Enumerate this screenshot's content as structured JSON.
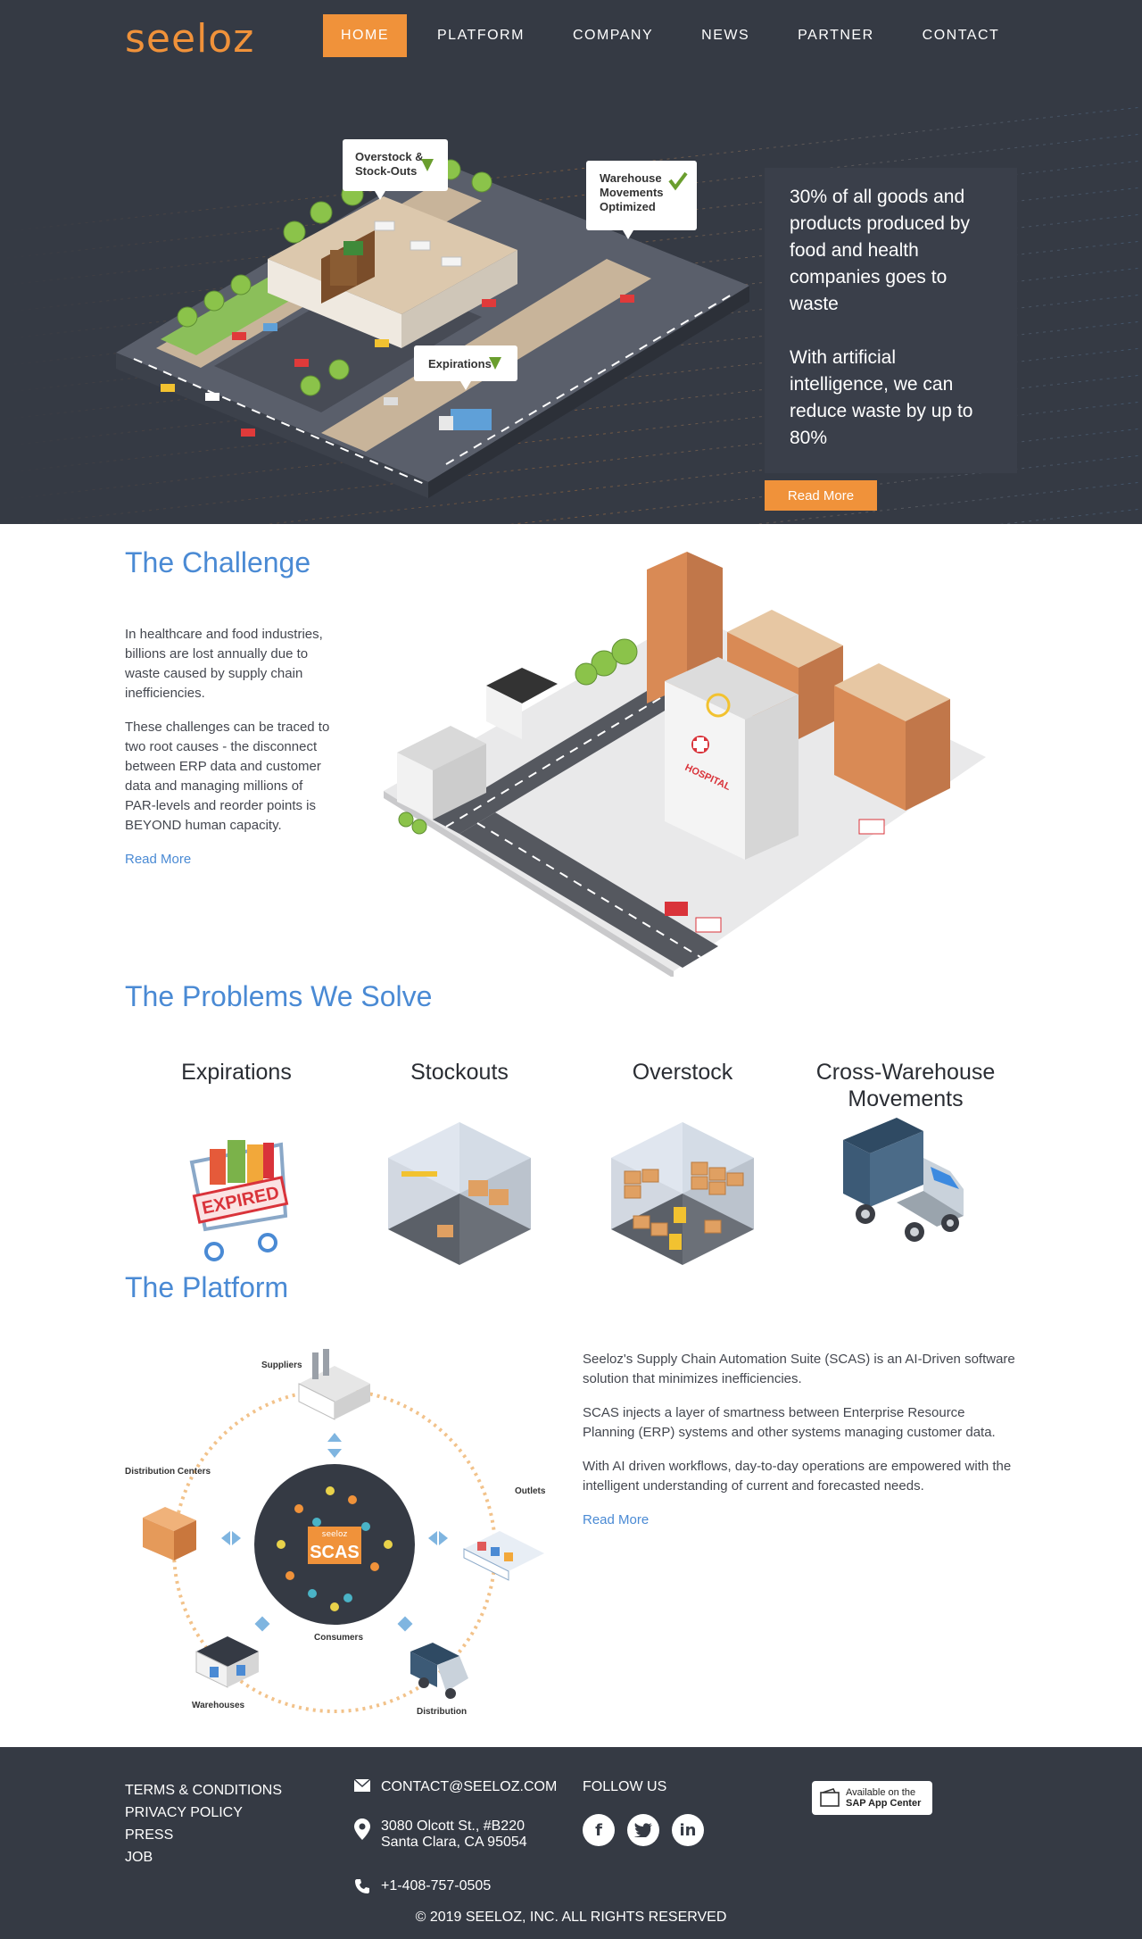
{
  "brand": {
    "logo_text": "seeloz",
    "accent_color": "#f0923a",
    "link_color": "#4a8ad4",
    "dark_bg": "#353a44"
  },
  "nav": {
    "items": [
      "HOME",
      "PLATFORM",
      "COMPANY",
      "NEWS",
      "PARTNER",
      "CONTACT"
    ],
    "active": "HOME"
  },
  "hero": {
    "illustration_tags": {
      "tag1": "Overstock & Stock-Outs",
      "tag2": "Warehouse Movements Optimized",
      "tag3": "Expirations"
    },
    "paragraph1": "30% of all goods and products produced by food and health companies goes to waste",
    "paragraph2": "With artificial intelligence, we can reduce waste by up to 80%",
    "button_label": "Read More"
  },
  "challenge": {
    "title": "The Challenge",
    "paragraph1": "In healthcare and food industries, billions are lost annually due to waste caused by supply chain inefficiencies.",
    "paragraph2": "These challenges can be traced to two root causes - the disconnect between ERP data and customer data and managing millions of PAR-levels and reorder points is BEYOND human capacity.",
    "link": "Read More",
    "hospital_sign": "HOSPITAL"
  },
  "problems": {
    "title": "The Problems We Solve",
    "items": [
      {
        "label": "Expirations",
        "icon": "expired-cart-icon",
        "badge": "EXPIRED"
      },
      {
        "label": "Stockouts",
        "icon": "empty-warehouse-icon"
      },
      {
        "label": "Overstock",
        "icon": "full-warehouse-icon"
      },
      {
        "label": "Cross-Warehouse Movements",
        "icon": "truck-icon"
      }
    ]
  },
  "platform": {
    "title": "The Platform",
    "diagram": {
      "center": "SCAS",
      "center_brand": "seeloz",
      "nodes": [
        "Suppliers",
        "Outlets",
        "Distribution",
        "Warehouses",
        "Distribution Centers",
        "Consumers"
      ]
    },
    "paragraph1": "Seeloz's Supply Chain Automation Suite (SCAS) is an AI-Driven software solution that minimizes inefficiencies.",
    "paragraph2": "SCAS injects a layer of smartness between Enterprise Resource Planning (ERP) systems and other systems managing customer data.",
    "paragraph3": "With AI driven workflows, day-to-day operations are empowered with the intelligent understanding of current and forecasted needs.",
    "link": "Read More"
  },
  "footer": {
    "links": [
      "TERMS & CONDITIONS",
      "PRIVACY POLICY",
      "PRESS",
      "JOB"
    ],
    "email": "CONTACT@SEELOZ.COM",
    "address_line1": "3080 Olcott St., #B220",
    "address_line2": "Santa Clara, CA 95054",
    "phone": "+1-408-757-0505",
    "follow_label": "FOLLOW US",
    "social": [
      "facebook-icon",
      "twitter-icon",
      "linkedin-icon"
    ],
    "sap_badge_line1": "Available on the",
    "sap_badge_line2": "SAP App Center",
    "copyright": "© 2019 SEELOZ, INC. ALL RIGHTS RESERVED"
  }
}
